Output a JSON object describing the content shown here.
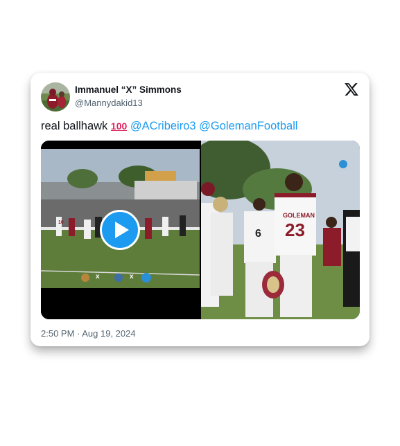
{
  "author": {
    "name": "Immanuel “X” Simmons",
    "handle": "@Mannydakid13"
  },
  "brand_icon": "x-logo-icon",
  "tweet": {
    "text": "real ballhawk",
    "emoji": "💯",
    "emoji_display": "100",
    "mentions": [
      "@ACribeiro3",
      "@GolemanFootball"
    ]
  },
  "media": {
    "video_overlay": "x",
    "video_overlay_2": "x",
    "jersey_front": "23",
    "jersey_back": "6",
    "jersey_side": "10",
    "school_name": "GOLEMAN"
  },
  "timestamp": "2:50 PM · Aug 19, 2024",
  "colors": {
    "link": "#1d9bf0",
    "text": "#0f1419",
    "muted": "#536471",
    "play_button": "#1d9bf0"
  }
}
